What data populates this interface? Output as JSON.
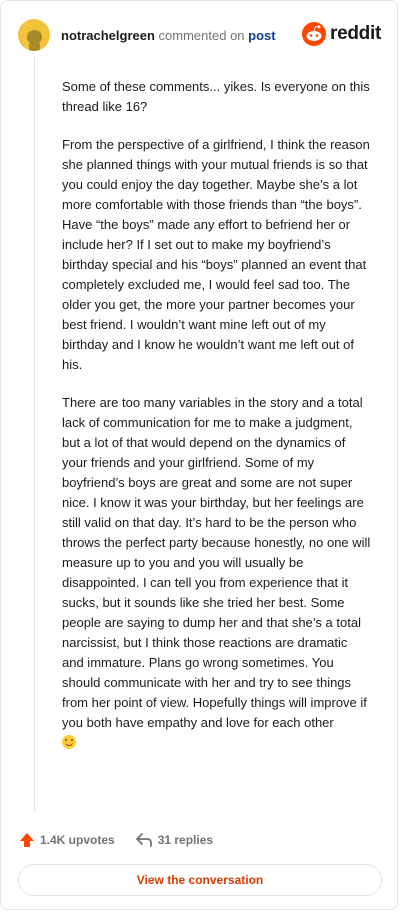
{
  "header": {
    "username": "notrachelgreen",
    "action_text": "commented on",
    "link_text": "post",
    "brand": "reddit"
  },
  "comment": {
    "paragraphs": [
      "Some of these comments... yikes. Is everyone on this thread like 16?",
      "From the perspective of a girlfriend, I think the reason she planned things with your mutual friends is so that you could enjoy the day together. Maybe she’s a lot more comfortable with those friends than “the boys”. Have “the boys” made any effort to befriend her or include her? If I set out to make my boyfriend’s birthday special and his “boys” planned an event that completely excluded me, I would feel sad too. The older you get, the more your partner becomes your best friend. I wouldn’t want mine left out of my birthday and I know he wouldn’t want me left out of his.",
      "There are too many variables in the story and a total lack of communication for me to make a judgment, but a lot of that would depend on the dynamics of your friends and your girlfriend. Some of my boyfriend’s boys are great and some are not super nice. I know it was your birthday, but her feelings are still valid on that day. It’s hard to be the person who throws the perfect party because honestly, no one will measure up to you and you will usually be disappointed. I can tell you from experience that it sucks, but it sounds like she tried her best. Some people are saying to dump her and that she’s a total narcissist, but I think those reactions are dramatic and immature. Plans go wrong sometimes. You should communicate with her and try to see things from her point of view. Hopefully things will improve if you both have empathy and love for each other"
    ],
    "trailing_emoji": "smiling-face-emoji"
  },
  "actions": {
    "upvotes": "1.4K upvotes",
    "replies": "31 replies"
  },
  "cta": {
    "label": "View the conversation"
  },
  "colors": {
    "accent": "#ff4500",
    "link": "#0b3f8f",
    "cta_text": "#d93900"
  }
}
